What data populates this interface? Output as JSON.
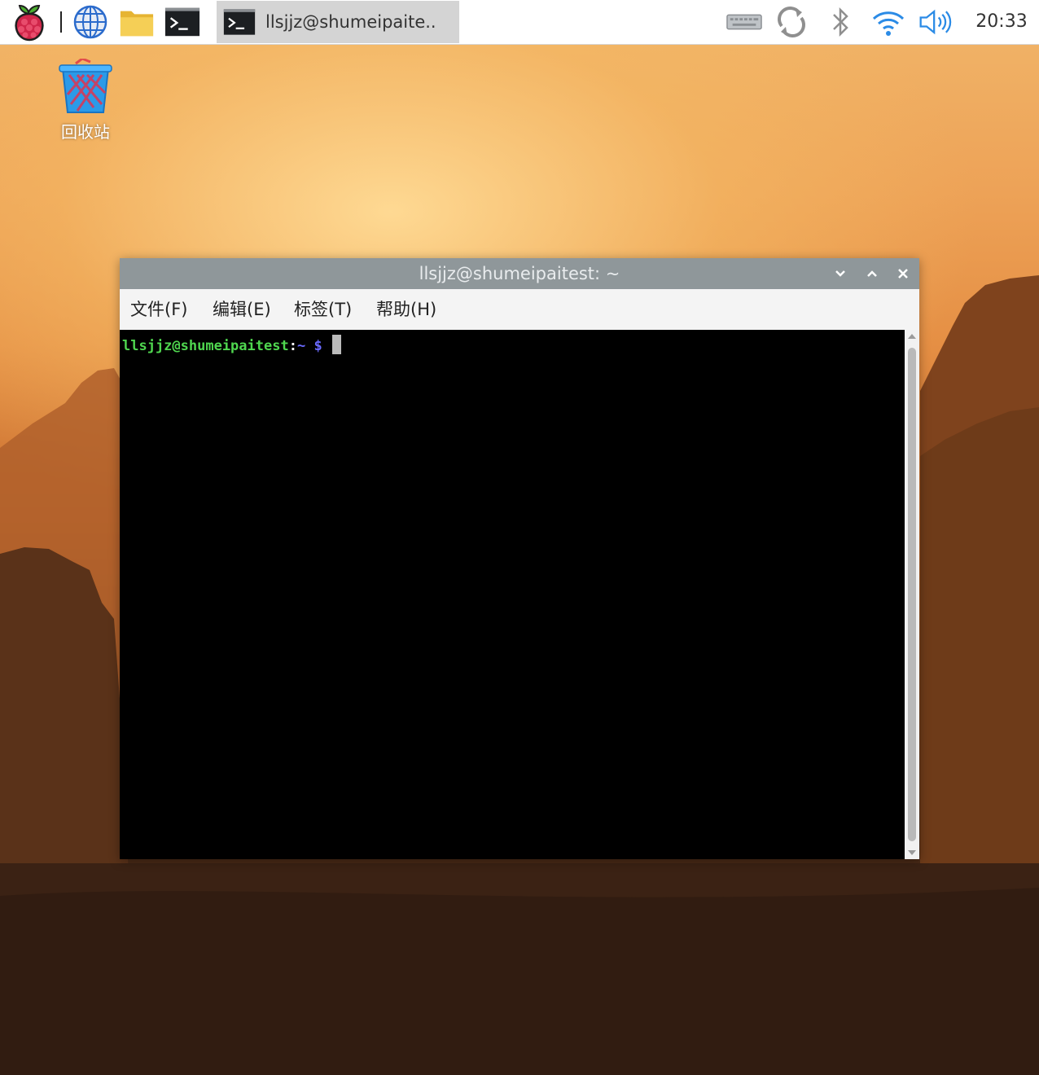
{
  "taskbar": {
    "launchers": [
      {
        "name": "raspberry-menu-icon"
      },
      {
        "name": "web-browser-icon"
      },
      {
        "name": "file-manager-icon"
      },
      {
        "name": "terminal-launcher-icon"
      }
    ],
    "task_button_label": "llsjjz@shumeipaite..",
    "tray": [
      {
        "name": "keyboard-icon"
      },
      {
        "name": "sync-update-icon"
      },
      {
        "name": "bluetooth-icon"
      },
      {
        "name": "wifi-icon"
      },
      {
        "name": "volume-icon"
      }
    ],
    "clock": "20:33"
  },
  "desktop": {
    "trash_label": "回收站"
  },
  "terminal": {
    "title": "llsjjz@shumeipaitest: ~",
    "menu": [
      "文件(F)",
      "编辑(E)",
      "标签(T)",
      "帮助(H)"
    ],
    "prompt": {
      "user_host": "llsjjz@shumeipaitest",
      "colon": ":",
      "path": "~",
      "symbol": "$"
    }
  },
  "colors": {
    "prompt_user": "#4fd64f",
    "prompt_path": "#6a6aff",
    "titlebar": "#8f979a",
    "accent_blue": "#2b8be6"
  }
}
